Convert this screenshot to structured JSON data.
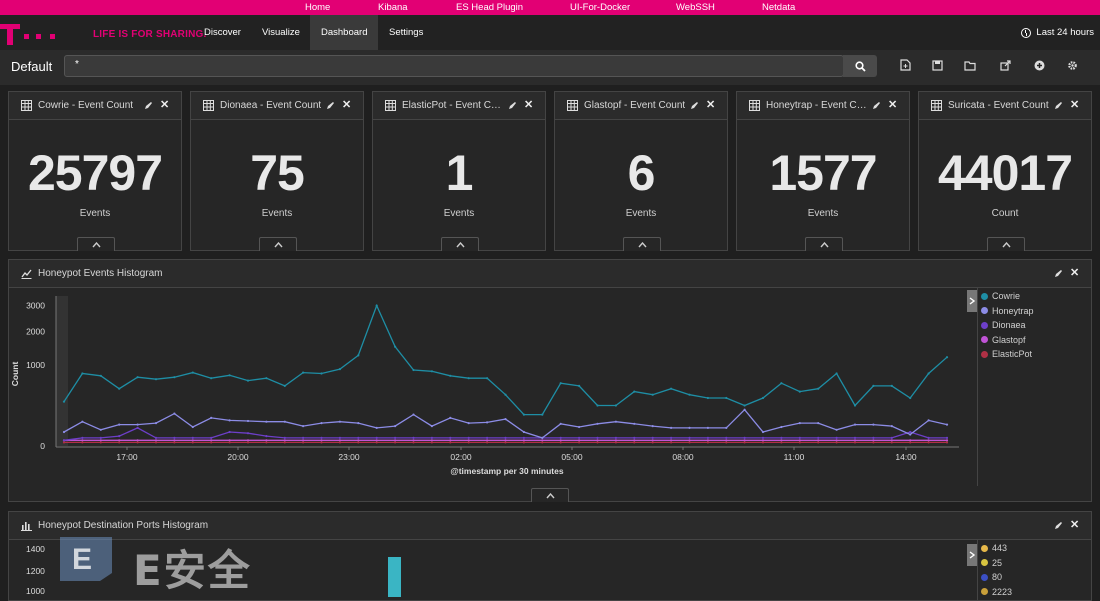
{
  "topbar": {
    "links": [
      "Home",
      "Kibana",
      "ES Head Plugin",
      "UI-For-Docker",
      "WebSSH",
      "Netdata"
    ]
  },
  "navbar": {
    "slogan": "LIFE IS FOR SHARING.",
    "links": [
      "Discover",
      "Visualize",
      "Dashboard",
      "Settings"
    ],
    "active": "Dashboard",
    "time_range": "Last 24 hours"
  },
  "search": {
    "dashboard_name": "Default",
    "query": "*"
  },
  "metrics": [
    {
      "title": "Cowrie - Event Count",
      "value": "25797",
      "label": "Events"
    },
    {
      "title": "Dionaea - Event Count",
      "value": "75",
      "label": "Events"
    },
    {
      "title": "ElasticPot - Event Count",
      "value": "1",
      "label": "Events"
    },
    {
      "title": "Glastopf - Event Count",
      "value": "6",
      "label": "Events"
    },
    {
      "title": "Honeytrap - Event Count",
      "value": "1577",
      "label": "Events"
    },
    {
      "title": "Suricata - Event Count",
      "value": "44017",
      "label": "Count"
    }
  ],
  "histogram": {
    "title": "Honeypot Events Histogram",
    "legend": [
      {
        "name": "Cowrie",
        "color": "#1e8ea5"
      },
      {
        "name": "Honeytrap",
        "color": "#8c8ce6"
      },
      {
        "name": "Dionaea",
        "color": "#6d3fc9"
      },
      {
        "name": "Glastopf",
        "color": "#c053d6"
      },
      {
        "name": "ElasticPot",
        "color": "#b03045"
      }
    ]
  },
  "ports_histogram": {
    "title": "Honeypot Destination Ports Histogram",
    "legend": [
      {
        "name": "443",
        "color": "#e6b84a"
      },
      {
        "name": "25",
        "color": "#d7c440"
      },
      {
        "name": "80",
        "color": "#3b4fc4"
      },
      {
        "name": "2223",
        "color": "#c9a03a"
      }
    ],
    "y_ticks": [
      "1400",
      "1200",
      "1000"
    ]
  },
  "watermark": {
    "text": "E安全"
  },
  "chart_data": [
    {
      "type": "line",
      "title": "Honeypot Events Histogram",
      "xlabel": "@timestamp per 30 minutes",
      "ylabel": "Count",
      "y_scale": "sqrt",
      "y_ticks": [
        0,
        1000,
        2000,
        3000
      ],
      "x_ticks": [
        "17:00",
        "20:00",
        "23:00",
        "02:00",
        "05:00",
        "08:00",
        "11:00",
        "14:00"
      ],
      "series": [
        {
          "name": "Cowrie",
          "values": [
            300,
            800,
            750,
            500,
            720,
            680,
            720,
            820,
            700,
            760,
            650,
            700,
            550,
            820,
            800,
            900,
            1250,
            3000,
            1500,
            880,
            850,
            750,
            700,
            700,
            400,
            150,
            150,
            600,
            550,
            250,
            250,
            450,
            400,
            500,
            400,
            350,
            350,
            250,
            350,
            600,
            450,
            500,
            800,
            250,
            550,
            550,
            350,
            800,
            1200
          ]
        },
        {
          "name": "Honeytrap",
          "values": [
            30,
            90,
            40,
            70,
            70,
            80,
            160,
            55,
            120,
            100,
            95,
            90,
            90,
            60,
            80,
            90,
            80,
            50,
            60,
            150,
            60,
            120,
            80,
            85,
            110,
            30,
            10,
            75,
            55,
            75,
            90,
            75,
            60,
            50,
            50,
            50,
            50,
            200,
            30,
            55,
            80,
            80,
            40,
            70,
            70,
            60,
            20,
            100,
            70
          ]
        },
        {
          "name": "Dionaea",
          "values": [
            5,
            10,
            10,
            15,
            50,
            10,
            10,
            10,
            10,
            30,
            25,
            15,
            10,
            10,
            10,
            10,
            10,
            10,
            10,
            10,
            10,
            10,
            10,
            10,
            10,
            10,
            10,
            10,
            10,
            10,
            10,
            10,
            10,
            10,
            10,
            10,
            10,
            10,
            10,
            10,
            10,
            10,
            10,
            10,
            10,
            10,
            30,
            10,
            10
          ]
        },
        {
          "name": "Glastopf",
          "values": [
            5,
            5,
            5,
            5,
            5,
            5,
            5,
            5,
            5,
            5,
            5,
            5,
            5,
            5,
            5,
            5,
            5,
            5,
            5,
            5,
            5,
            5,
            5,
            5,
            5,
            5,
            5,
            5,
            5,
            5,
            5,
            5,
            5,
            5,
            5,
            5,
            5,
            5,
            5,
            5,
            5,
            5,
            5,
            5,
            5,
            5,
            5,
            5,
            5
          ]
        },
        {
          "name": "ElasticPot",
          "values": [
            2,
            2,
            2,
            2,
            2,
            2,
            2,
            2,
            2,
            2,
            2,
            2,
            2,
            2,
            2,
            2,
            2,
            2,
            2,
            2,
            2,
            2,
            2,
            2,
            2,
            2,
            2,
            2,
            2,
            2,
            2,
            2,
            2,
            2,
            2,
            2,
            2,
            2,
            2,
            2,
            2,
            2,
            2,
            2,
            2,
            2,
            2,
            2,
            2
          ]
        }
      ]
    }
  ]
}
